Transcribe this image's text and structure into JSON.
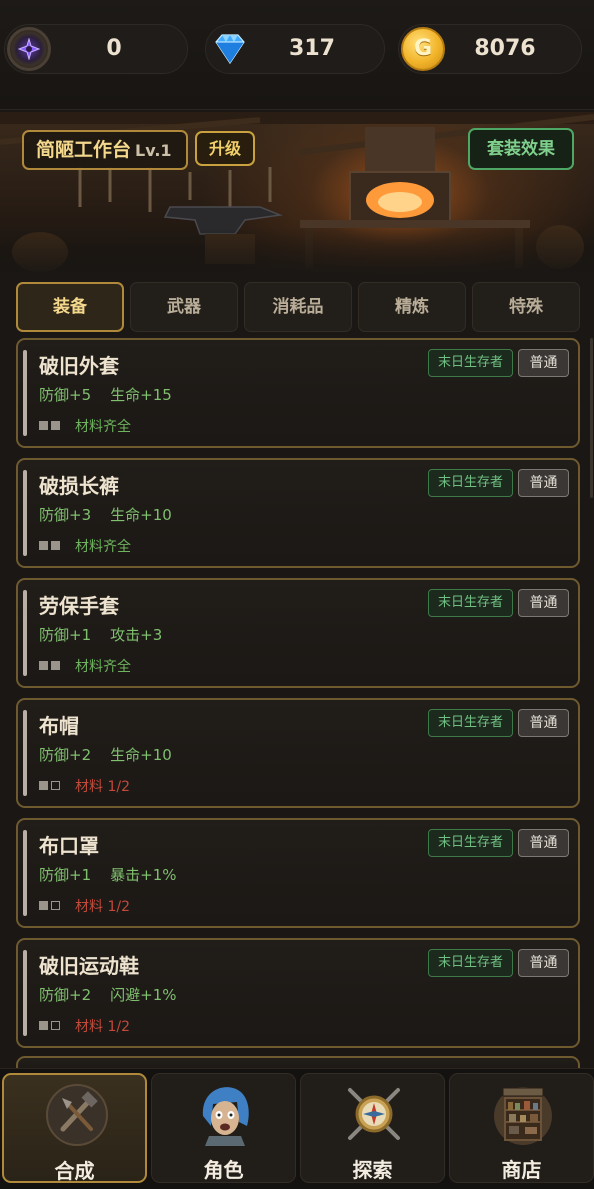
{
  "currencies": {
    "rune": {
      "icon": "purple-rune-icon",
      "value": "0"
    },
    "diamond": {
      "icon": "diamond-icon",
      "value": "317"
    },
    "gold": {
      "icon": "gold-coin-icon",
      "glyph": "G",
      "value": "8076"
    }
  },
  "station": {
    "name": "简陋工作台",
    "level": "Lv.1",
    "upgrade_label": "升级",
    "set_effect_label": "套装效果"
  },
  "tabs": [
    {
      "label": "装备",
      "active": true
    },
    {
      "label": "武器",
      "active": false
    },
    {
      "label": "消耗品",
      "active": false
    },
    {
      "label": "精炼",
      "active": false
    },
    {
      "label": "特殊",
      "active": false
    }
  ],
  "recipes": [
    {
      "name": "破旧外套",
      "stats": "防御+5    生命+15",
      "set_tag": "末日生存者",
      "rarity": "普通",
      "materials_have": 2,
      "materials_total": 2,
      "materials_text": "材料齐全",
      "complete": true
    },
    {
      "name": "破损长裤",
      "stats": "防御+3    生命+10",
      "set_tag": "末日生存者",
      "rarity": "普通",
      "materials_have": 2,
      "materials_total": 2,
      "materials_text": "材料齐全",
      "complete": true
    },
    {
      "name": "劳保手套",
      "stats": "防御+1    攻击+3",
      "set_tag": "末日生存者",
      "rarity": "普通",
      "materials_have": 2,
      "materials_total": 2,
      "materials_text": "材料齐全",
      "complete": true
    },
    {
      "name": "布帽",
      "stats": "防御+2    生命+10",
      "set_tag": "末日生存者",
      "rarity": "普通",
      "materials_have": 1,
      "materials_total": 2,
      "materials_text": "材料 1/2",
      "complete": false
    },
    {
      "name": "布口罩",
      "stats": "防御+1    暴击+1%",
      "set_tag": "末日生存者",
      "rarity": "普通",
      "materials_have": 1,
      "materials_total": 2,
      "materials_text": "材料 1/2",
      "complete": false
    },
    {
      "name": "破旧运动鞋",
      "stats": "防御+2    闪避+1%",
      "set_tag": "末日生存者",
      "rarity": "普通",
      "materials_have": 1,
      "materials_total": 2,
      "materials_text": "材料 1/2",
      "complete": false
    }
  ],
  "bottom_nav": [
    {
      "label": "合成",
      "icon": "crafting-tools-icon",
      "active": true
    },
    {
      "label": "角色",
      "icon": "character-portrait-icon",
      "active": false
    },
    {
      "label": "探索",
      "icon": "compass-swords-icon",
      "active": false
    },
    {
      "label": "商店",
      "icon": "shop-shelf-icon",
      "active": false
    }
  ]
}
